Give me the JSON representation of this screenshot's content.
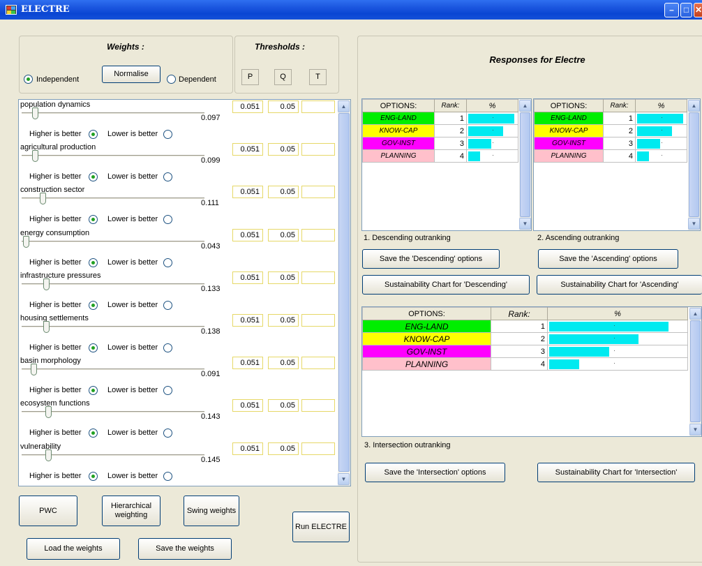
{
  "window": {
    "title": "ELECTRE",
    "title_colors": {
      "bar": "#0a46d3"
    }
  },
  "left": {
    "weights_header": "Weights :",
    "thresholds_header": "Thresholds :",
    "independent_label": "Independent",
    "dependent_label": "Dependent",
    "normalise_label": "Normalise",
    "threshold_labels": [
      "P",
      "Q",
      "T"
    ],
    "higher_label": "Higher  is better",
    "lower_label": "Lower is better",
    "criteria": [
      {
        "name": "population dynamics",
        "weight": "0.097",
        "p": "0.051",
        "q": "0.05",
        "level": 0.07
      },
      {
        "name": "agricultural production",
        "weight": "0.099",
        "p": "0.051",
        "q": "0.05",
        "level": 0.07
      },
      {
        "name": "construction sector",
        "weight": "0.111",
        "p": "0.051",
        "q": "0.05",
        "level": 0.11
      },
      {
        "name": "energy consumption",
        "weight": "0.043",
        "p": "0.051",
        "q": "0.05",
        "level": 0.02
      },
      {
        "name": "infrastructure pressures",
        "weight": "0.133",
        "p": "0.051",
        "q": "0.05",
        "level": 0.13
      },
      {
        "name": "housing settlements",
        "weight": "0.138",
        "p": "0.051",
        "q": "0.05",
        "level": 0.13
      },
      {
        "name": "basin morphology",
        "weight": "0.091",
        "p": "0.051",
        "q": "0.05",
        "level": 0.06
      },
      {
        "name": "ecosystem functions",
        "weight": "0.143",
        "p": "0.051",
        "q": "0.05",
        "level": 0.14
      },
      {
        "name": "vulnerability",
        "weight": "0.145",
        "p": "0.051",
        "q": "0.05",
        "level": 0.14
      }
    ],
    "buttons": {
      "pwc": "PWC",
      "hierarchical": "Hierarchical weighting",
      "swing": "Swing weights",
      "run": "Run ELECTRE",
      "load": "Load the weights",
      "save": "Save the weights"
    }
  },
  "right": {
    "header": "Responses for Electre",
    "grid_headers": {
      "options": "OPTIONS:",
      "rank": "Rank:",
      "pct": "%"
    },
    "options": [
      {
        "name": "ENG-LAND",
        "color": "#00ee00"
      },
      {
        "name": "KNOW-CAP",
        "color": "#ffff00"
      },
      {
        "name": "GOV-INST",
        "color": "#ff00ff"
      },
      {
        "name": "PLANNING",
        "color": "#ffc0cb"
      }
    ],
    "descending": {
      "caption": "1. Descending outranking",
      "ranks": [
        "1",
        "2",
        "3",
        "4"
      ],
      "pct": [
        1.0,
        0.75,
        0.5,
        0.25
      ]
    },
    "ascending": {
      "caption": "2. Ascending outranking",
      "ranks": [
        "1",
        "2",
        "3",
        "4"
      ],
      "pct": [
        1.0,
        0.75,
        0.5,
        0.25
      ]
    },
    "intersection": {
      "caption": "3. Intersection outranking",
      "ranks": [
        "1",
        "2",
        "3",
        "4"
      ],
      "pct": [
        1.0,
        0.75,
        0.5,
        0.25
      ]
    },
    "buttons": {
      "save_desc": "Save the 'Descending' options",
      "save_asc": "Save the 'Ascending' options",
      "chart_desc": "Sustainability Chart for 'Descending'",
      "chart_asc": "Sustainability Chart for 'Ascending'",
      "save_int": "Save the 'Intersection' options",
      "chart_int": "Sustainability Chart for 'Intersection'"
    }
  }
}
